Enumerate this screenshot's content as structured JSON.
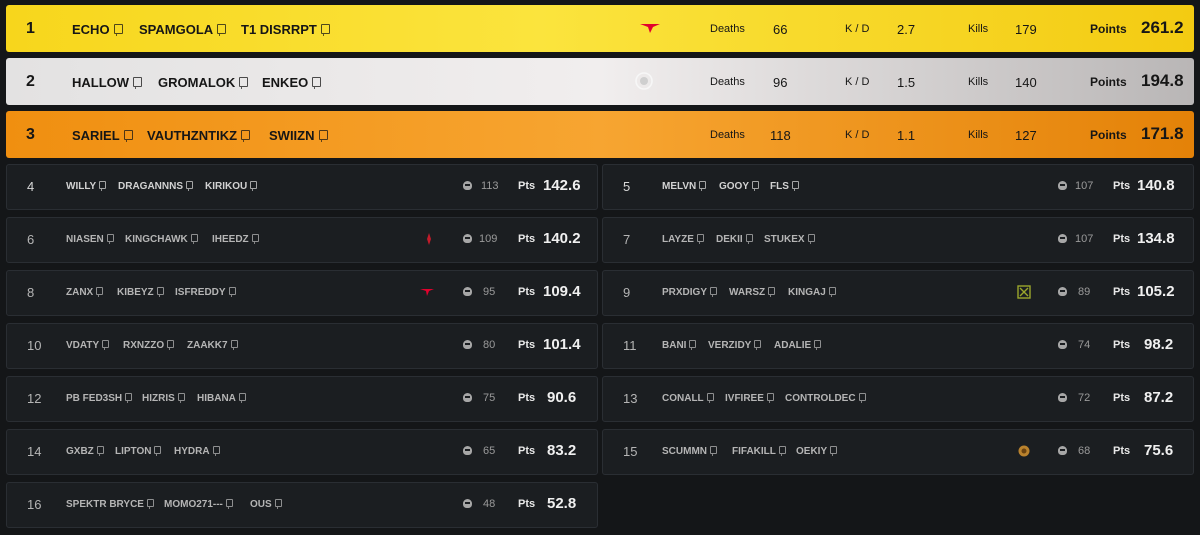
{
  "labels": {
    "deaths": "Deaths",
    "kd": "K / D",
    "kills": "Kills",
    "points": "Points",
    "pts": "Pts"
  },
  "top3": [
    {
      "rank": "1",
      "players": [
        "ECHO",
        "SPAMGOLA",
        "T1 DISRRPT"
      ],
      "logo": "t1-logo",
      "deaths": "66",
      "kd": "2.7",
      "kills": "179",
      "points": "261.2"
    },
    {
      "rank": "2",
      "players": [
        "HALLOW",
        "GROMALOK",
        "ENKEO"
      ],
      "logo": "team-crest-logo",
      "deaths": "96",
      "kd": "1.5",
      "kills": "140",
      "points": "194.8"
    },
    {
      "rank": "3",
      "players": [
        "SARIEL",
        "VAUTHZNTIKZ",
        "SWIIZN"
      ],
      "logo": "",
      "deaths": "118",
      "kd": "1.1",
      "kills": "127",
      "points": "171.8"
    }
  ],
  "rows": [
    {
      "rank": "4",
      "players": [
        "WILLY",
        "DRAGANNNS",
        "KIRIKOU"
      ],
      "logo": "",
      "kills": "113",
      "pts": "142.6"
    },
    {
      "rank": "5",
      "players": [
        "MELVN",
        "GOOY",
        "FLS"
      ],
      "logo": "",
      "kills": "107",
      "pts": "140.8"
    },
    {
      "rank": "6",
      "players": [
        "NIASEN",
        "KINGCHAWK",
        "IHEEDZ"
      ],
      "logo": "red-team-logo",
      "kills": "109",
      "pts": "140.2"
    },
    {
      "rank": "7",
      "players": [
        "LAYZE",
        "DEKII",
        "STUKEX"
      ],
      "logo": "",
      "kills": "107",
      "pts": "134.8"
    },
    {
      "rank": "8",
      "players": [
        "ZANX",
        "KIBEYZ",
        "ISFREDDY"
      ],
      "logo": "t1-logo",
      "kills": "95",
      "pts": "109.4"
    },
    {
      "rank": "9",
      "players": [
        "PRXDIGY",
        "WARSZ",
        "KINGAJ"
      ],
      "logo": "green-team-logo",
      "kills": "89",
      "pts": "105.2"
    },
    {
      "rank": "10",
      "players": [
        "VDATY",
        "RXNZZO",
        "ZAAKK7"
      ],
      "logo": "",
      "kills": "80",
      "pts": "101.4"
    },
    {
      "rank": "11",
      "players": [
        "BANI",
        "VERZIDY",
        "ADALIE"
      ],
      "logo": "",
      "kills": "74",
      "pts": "98.2"
    },
    {
      "rank": "12",
      "players": [
        "PB FED3SH",
        "HIZRIS",
        "HIBANA"
      ],
      "logo": "",
      "kills": "75",
      "pts": "90.6"
    },
    {
      "rank": "13",
      "players": [
        "CONALL",
        "IVFIREE",
        "CONTROLDEC"
      ],
      "logo": "",
      "kills": "72",
      "pts": "87.2"
    },
    {
      "rank": "14",
      "players": [
        "GXBZ",
        "LIPTON",
        "HYDRA"
      ],
      "logo": "",
      "kills": "65",
      "pts": "83.2"
    },
    {
      "rank": "15",
      "players": [
        "SCUMMN",
        "FIFAKILL",
        "OEKIY"
      ],
      "logo": "gold-team-logo",
      "kills": "68",
      "pts": "75.6"
    },
    {
      "rank": "16",
      "players": [
        "SPEKTR BRYCE",
        "MOMO271---",
        "OUS"
      ],
      "logo": "",
      "kills": "48",
      "pts": "52.8"
    }
  ],
  "colors": {
    "gold": "#f7d61c",
    "silver": "#e3e2e2",
    "bronze": "#f08f10",
    "card": "#1b1e21",
    "t1_red": "#e2012d"
  }
}
